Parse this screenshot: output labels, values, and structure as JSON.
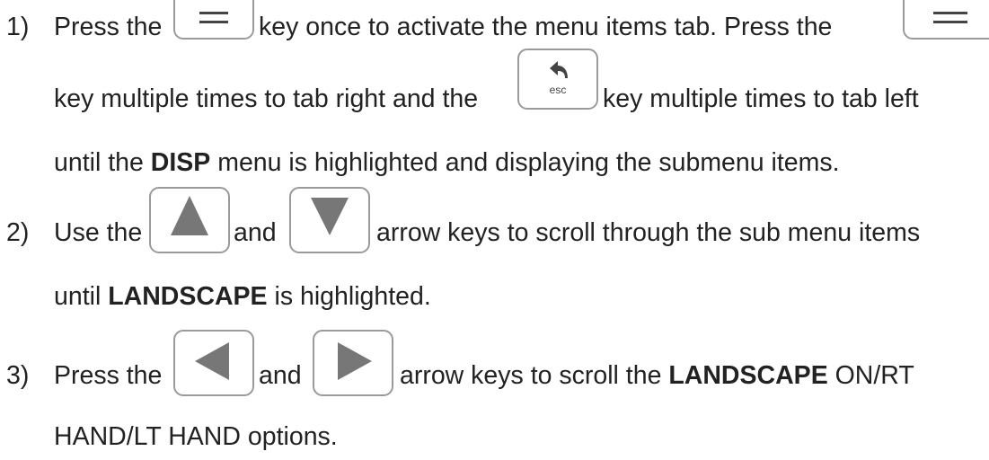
{
  "steps": [
    {
      "number": "1)",
      "l1a": "Press the",
      "l1b": "key once to activate the menu items tab.  Press the",
      "l2a": "key multiple times to tab right and the",
      "l2b": "key multiple times to tab left",
      "l3a": "until the",
      "l3b": "DISP",
      "l3c": "menu is highlighted and displaying the submenu items."
    },
    {
      "number": "2)",
      "l1a": "Use the",
      "l1b": "and",
      "l1c": "arrow keys to scroll through the sub menu items",
      "l2a": "until",
      "l2b": "LANDSCAPE",
      "l2c": "is highlighted."
    },
    {
      "number": "3)",
      "l1a": "Press the",
      "l1b": "and",
      "l1c": "arrow keys to scroll the",
      "l1d": "LANDSCAPE",
      "l1e": "ON/RT",
      "l2": "HAND/LT HAND options."
    }
  ],
  "keys": {
    "menu": "menu-key",
    "esc_label": "esc",
    "up": "arrow-up-key",
    "down": "arrow-down-key",
    "left": "arrow-left-key",
    "right": "arrow-right-key"
  }
}
